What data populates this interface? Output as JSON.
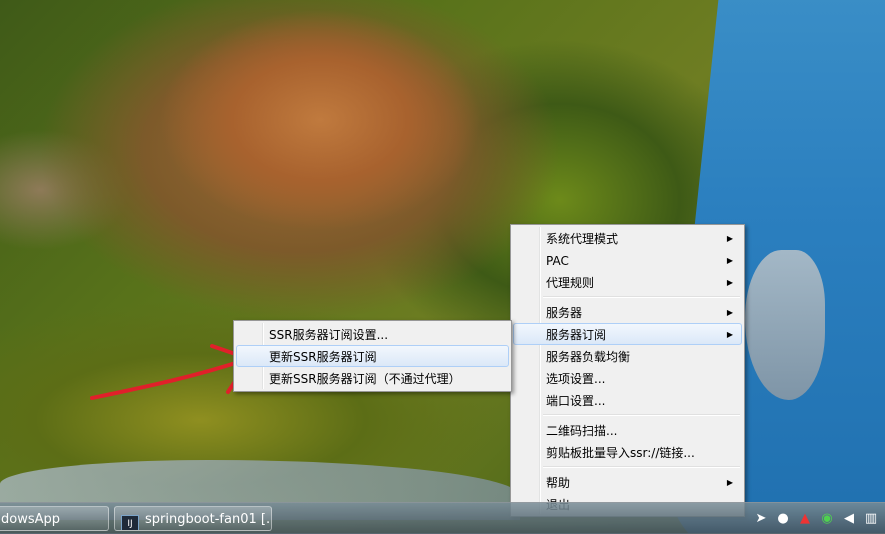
{
  "menu_main": {
    "groups": [
      [
        {
          "label": "系统代理模式",
          "submenu": true
        },
        {
          "label": "PAC",
          "submenu": true
        },
        {
          "label": "代理规则",
          "submenu": true
        }
      ],
      [
        {
          "label": "服务器",
          "submenu": true
        },
        {
          "label": "服务器订阅",
          "submenu": true,
          "highlighted": true
        },
        {
          "label": "服务器负载均衡",
          "submenu": false
        },
        {
          "label": "选项设置...",
          "submenu": false
        },
        {
          "label": "端口设置...",
          "submenu": false
        }
      ],
      [
        {
          "label": "二维码扫描...",
          "submenu": false
        },
        {
          "label": "剪贴板批量导入ssr://链接...",
          "submenu": false
        }
      ],
      [
        {
          "label": "帮助",
          "submenu": true
        },
        {
          "label": "退出",
          "submenu": false
        }
      ]
    ]
  },
  "menu_sub": {
    "items": [
      {
        "label": "SSR服务器订阅设置..."
      },
      {
        "label": "更新SSR服务器订阅",
        "highlighted": true
      },
      {
        "label": "更新SSR服务器订阅（不通过代理）"
      }
    ]
  },
  "taskbar": {
    "buttons": [
      {
        "label": "dowsApp"
      },
      {
        "label": "springboot-fan01 [..."
      }
    ],
    "tray_icons": [
      "arrow-cursor-icon",
      "penguin-qq-icon",
      "red-app-icon",
      "wechat-icon",
      "speaker-icon",
      "network-icon"
    ]
  },
  "colors": {
    "arrow": "#e0202a",
    "menu_bg": "#f0f0f0",
    "highlight_border": "#aecff7"
  }
}
